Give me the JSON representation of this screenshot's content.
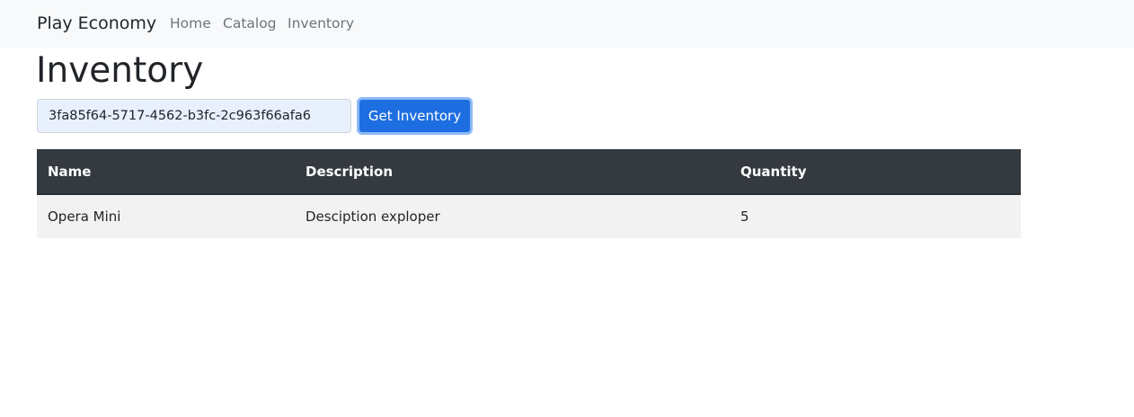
{
  "navbar": {
    "brand": "Play Economy",
    "links": [
      {
        "label": "Home"
      },
      {
        "label": "Catalog"
      },
      {
        "label": "Inventory"
      }
    ]
  },
  "page": {
    "title": "Inventory"
  },
  "form": {
    "user_id_value": "3fa85f64-5717-4562-b3fc-2c963f66afa6",
    "button_label": "Get Inventory"
  },
  "table": {
    "headers": [
      "Name",
      "Description",
      "Quantity"
    ],
    "rows": [
      {
        "name": "Opera Mini",
        "description": "Desciption exploper",
        "quantity": "5"
      }
    ]
  }
}
